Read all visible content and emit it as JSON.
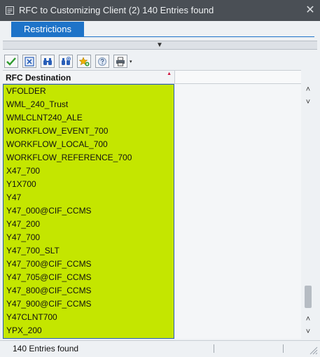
{
  "window": {
    "title": "RFC to Customizing Client (2)  140 Entries found",
    "close_glyph": "✕"
  },
  "tabs": [
    {
      "label": "Restrictions",
      "active": true
    }
  ],
  "splitter": {
    "glyph": "▼"
  },
  "toolbar": {
    "buttons": [
      {
        "name": "check-icon",
        "tooltip": ""
      },
      {
        "name": "cancel-icon"
      },
      {
        "name": "find-icon"
      },
      {
        "name": "find-next-icon"
      },
      {
        "name": "add-favorite-icon"
      },
      {
        "name": "help-icon"
      },
      {
        "name": "print-icon"
      }
    ],
    "dropdown_glyph": "▾"
  },
  "table": {
    "column_header": "RFC Destination",
    "sort_glyph": "▲",
    "rows": [
      "VFOLDER",
      "WML_240_Trust",
      "WMLCLNT240_ALE",
      "WORKFLOW_EVENT_700",
      "WORKFLOW_LOCAL_700",
      "WORKFLOW_REFERENCE_700",
      "X47_700",
      "Y1X700",
      "Y47",
      "Y47_000@CIF_CCMS",
      "Y47_200",
      "Y47_700",
      "Y47_700_SLT",
      "Y47_700@CIF_CCMS",
      "Y47_705@CIF_CCMS",
      "Y47_800@CIF_CCMS",
      "Y47_900@CIF_CCMS",
      "Y47CLNT700",
      "YPX_200"
    ],
    "highlight_color": "#c4e600"
  },
  "scrollbar": {
    "up_glyph": "˄",
    "down_glyph": "˅"
  },
  "status": {
    "text": "140 Entries found"
  },
  "colors": {
    "titlebar": "#4a4f55",
    "tab_active": "#1e73c8",
    "selection_border": "#2a5fb8"
  }
}
